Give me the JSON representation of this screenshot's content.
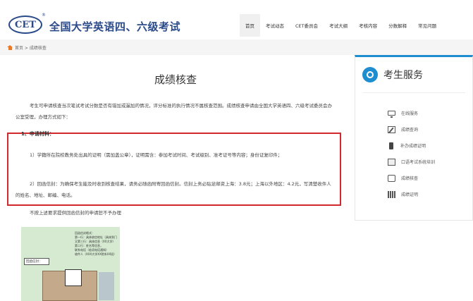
{
  "header": {
    "logo_text": "CET",
    "logo_reg": "®",
    "site_title": "全国大学英语四、六级考试",
    "nav": [
      "首页",
      "考试动态",
      "CET委员会",
      "考试大纲",
      "考核内容",
      "分数解释",
      "常见问题"
    ],
    "active_nav_index": 0
  },
  "breadcrumb": {
    "text": "首页 > 成绩核查"
  },
  "article": {
    "title": "成绩核查",
    "intro": "考生可申请核查当次笔试考试分数是否有错加或漏加的情况，评分标准的执行情况不属核查范围。成绩核查申请由全国大学英语四、六级考试委员会办公室受理，办理方式如下：",
    "section_head": "1、申请材料：",
    "item1": "1）学籍所在院校教务处出具的证明（需加盖公章），证明需含：参加考试时间、考试级别、准考证号等内容；身份证复印件；",
    "item2": "2）回函信封：为确保考生能及时收到核查结果，请务必随函附寄回函信封。信封上务必贴足邮资上海：3.8元；上海以外地区：4.2元，写清楚收件人的姓名、地址、邮编、电话。",
    "note": "不按上述要求提供回函信封的申请恕不予办理"
  },
  "envelope_sample": {
    "label": "回函信封：",
    "lines": [
      "回函信封格式：",
      "第一行：具体收信地址（具体到门牌号码）",
      "又第三行：具体信息（XX大学）",
      "第二行：姓名等信息，",
      "联系电话（若须电话通知）",
      "收件人（XXX大学XX院系XX班）"
    ]
  },
  "sidebar": {
    "title": "考生服务",
    "items": [
      {
        "label": "在线服务",
        "icon": "monitor-icon"
      },
      {
        "label": "成绩查询",
        "icon": "edit-icon"
      },
      {
        "label": "补办成绩证明",
        "icon": "phone-icon"
      },
      {
        "label": "口语考试系统培训",
        "icon": "card-icon"
      },
      {
        "label": "成绩核查",
        "icon": "box-icon"
      },
      {
        "label": "成绩证明",
        "icon": "book-icon"
      }
    ]
  },
  "colors": {
    "brand": "#2b4a8a",
    "accent": "#1f8ed0",
    "highlight_border": "#d0282b",
    "home_icon": "#e8792b"
  }
}
